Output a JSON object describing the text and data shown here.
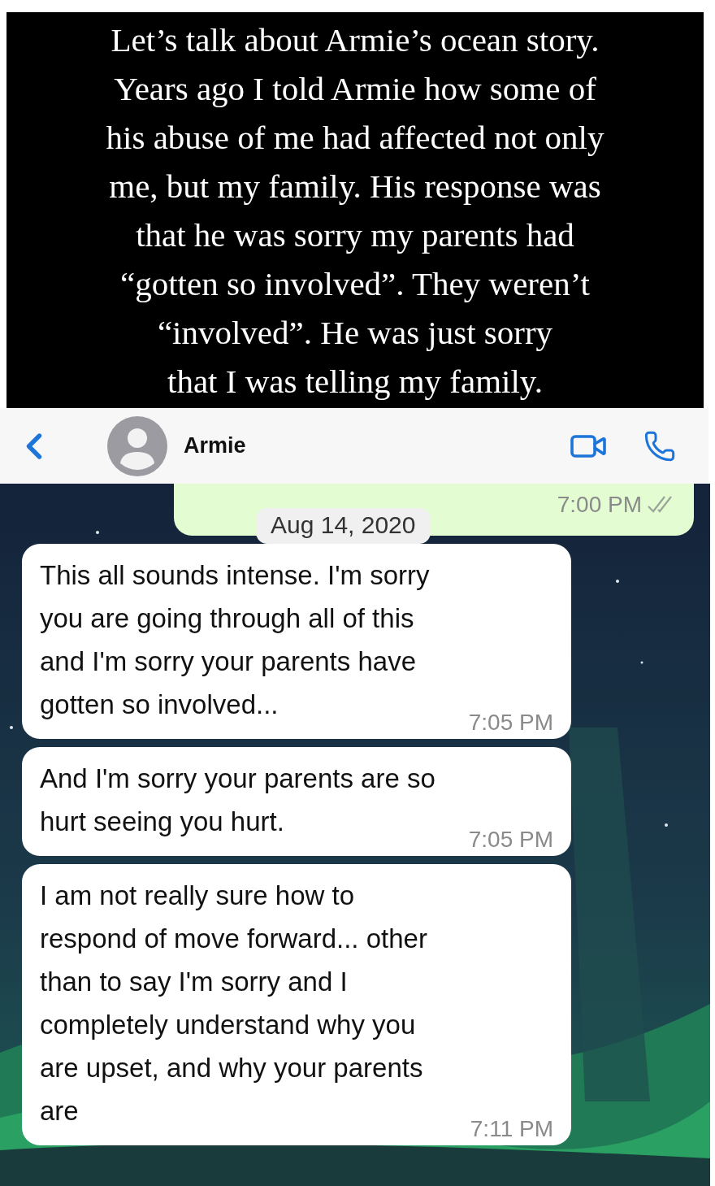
{
  "caption": {
    "lines": [
      "Let’s talk about Armie’s ocean story.",
      "Years ago I told Armie how some of",
      "his abuse of me had affected not only",
      "me, but my family. His response was",
      "that he was sorry my parents had",
      "“gotten so involved”. They weren’t",
      "“involved”. He was just sorry",
      "that I was telling my family."
    ]
  },
  "header": {
    "contact_name": "Armie"
  },
  "chat": {
    "date": "Aug 14, 2020",
    "messages": [
      {
        "kind": "sent",
        "time": "7:00 PM",
        "read": true
      },
      {
        "kind": "received",
        "lines": [
          "This all sounds intense. I'm sorry",
          "you are going through all of this",
          "and I'm sorry your parents have",
          "gotten so involved..."
        ],
        "time": "7:05 PM"
      },
      {
        "kind": "received",
        "lines": [
          "And I'm sorry your parents are so",
          "hurt seeing you hurt."
        ],
        "time": "7:05 PM"
      },
      {
        "kind": "received",
        "lines": [
          "I am not really sure how to",
          "respond of move forward... other",
          "than to say I'm sorry and I",
          "completely understand why you",
          "are upset, and why your parents",
          "are"
        ],
        "time": "7:11 PM"
      }
    ]
  }
}
